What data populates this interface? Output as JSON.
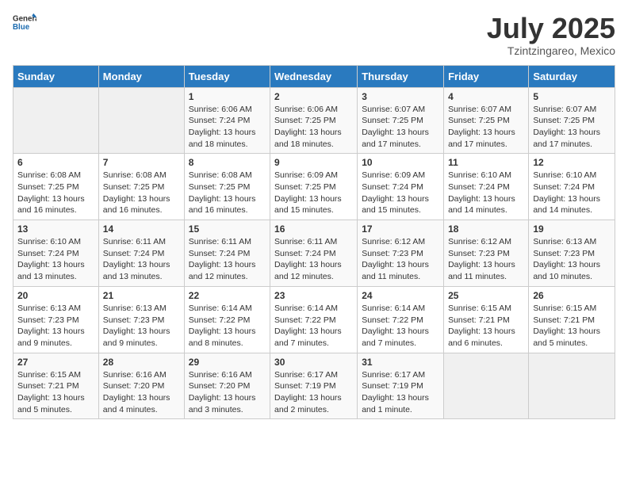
{
  "logo": {
    "general": "General",
    "blue": "Blue"
  },
  "title": {
    "month": "July 2025",
    "location": "Tzintzingareo, Mexico"
  },
  "weekdays": [
    "Sunday",
    "Monday",
    "Tuesday",
    "Wednesday",
    "Thursday",
    "Friday",
    "Saturday"
  ],
  "weeks": [
    [
      null,
      null,
      {
        "day": 1,
        "sunrise": "Sunrise: 6:06 AM",
        "sunset": "Sunset: 7:24 PM",
        "daylight": "Daylight: 13 hours and 18 minutes."
      },
      {
        "day": 2,
        "sunrise": "Sunrise: 6:06 AM",
        "sunset": "Sunset: 7:25 PM",
        "daylight": "Daylight: 13 hours and 18 minutes."
      },
      {
        "day": 3,
        "sunrise": "Sunrise: 6:07 AM",
        "sunset": "Sunset: 7:25 PM",
        "daylight": "Daylight: 13 hours and 17 minutes."
      },
      {
        "day": 4,
        "sunrise": "Sunrise: 6:07 AM",
        "sunset": "Sunset: 7:25 PM",
        "daylight": "Daylight: 13 hours and 17 minutes."
      },
      {
        "day": 5,
        "sunrise": "Sunrise: 6:07 AM",
        "sunset": "Sunset: 7:25 PM",
        "daylight": "Daylight: 13 hours and 17 minutes."
      }
    ],
    [
      {
        "day": 6,
        "sunrise": "Sunrise: 6:08 AM",
        "sunset": "Sunset: 7:25 PM",
        "daylight": "Daylight: 13 hours and 16 minutes."
      },
      {
        "day": 7,
        "sunrise": "Sunrise: 6:08 AM",
        "sunset": "Sunset: 7:25 PM",
        "daylight": "Daylight: 13 hours and 16 minutes."
      },
      {
        "day": 8,
        "sunrise": "Sunrise: 6:08 AM",
        "sunset": "Sunset: 7:25 PM",
        "daylight": "Daylight: 13 hours and 16 minutes."
      },
      {
        "day": 9,
        "sunrise": "Sunrise: 6:09 AM",
        "sunset": "Sunset: 7:25 PM",
        "daylight": "Daylight: 13 hours and 15 minutes."
      },
      {
        "day": 10,
        "sunrise": "Sunrise: 6:09 AM",
        "sunset": "Sunset: 7:24 PM",
        "daylight": "Daylight: 13 hours and 15 minutes."
      },
      {
        "day": 11,
        "sunrise": "Sunrise: 6:10 AM",
        "sunset": "Sunset: 7:24 PM",
        "daylight": "Daylight: 13 hours and 14 minutes."
      },
      {
        "day": 12,
        "sunrise": "Sunrise: 6:10 AM",
        "sunset": "Sunset: 7:24 PM",
        "daylight": "Daylight: 13 hours and 14 minutes."
      }
    ],
    [
      {
        "day": 13,
        "sunrise": "Sunrise: 6:10 AM",
        "sunset": "Sunset: 7:24 PM",
        "daylight": "Daylight: 13 hours and 13 minutes."
      },
      {
        "day": 14,
        "sunrise": "Sunrise: 6:11 AM",
        "sunset": "Sunset: 7:24 PM",
        "daylight": "Daylight: 13 hours and 13 minutes."
      },
      {
        "day": 15,
        "sunrise": "Sunrise: 6:11 AM",
        "sunset": "Sunset: 7:24 PM",
        "daylight": "Daylight: 13 hours and 12 minutes."
      },
      {
        "day": 16,
        "sunrise": "Sunrise: 6:11 AM",
        "sunset": "Sunset: 7:24 PM",
        "daylight": "Daylight: 13 hours and 12 minutes."
      },
      {
        "day": 17,
        "sunrise": "Sunrise: 6:12 AM",
        "sunset": "Sunset: 7:23 PM",
        "daylight": "Daylight: 13 hours and 11 minutes."
      },
      {
        "day": 18,
        "sunrise": "Sunrise: 6:12 AM",
        "sunset": "Sunset: 7:23 PM",
        "daylight": "Daylight: 13 hours and 11 minutes."
      },
      {
        "day": 19,
        "sunrise": "Sunrise: 6:13 AM",
        "sunset": "Sunset: 7:23 PM",
        "daylight": "Daylight: 13 hours and 10 minutes."
      }
    ],
    [
      {
        "day": 20,
        "sunrise": "Sunrise: 6:13 AM",
        "sunset": "Sunset: 7:23 PM",
        "daylight": "Daylight: 13 hours and 9 minutes."
      },
      {
        "day": 21,
        "sunrise": "Sunrise: 6:13 AM",
        "sunset": "Sunset: 7:23 PM",
        "daylight": "Daylight: 13 hours and 9 minutes."
      },
      {
        "day": 22,
        "sunrise": "Sunrise: 6:14 AM",
        "sunset": "Sunset: 7:22 PM",
        "daylight": "Daylight: 13 hours and 8 minutes."
      },
      {
        "day": 23,
        "sunrise": "Sunrise: 6:14 AM",
        "sunset": "Sunset: 7:22 PM",
        "daylight": "Daylight: 13 hours and 7 minutes."
      },
      {
        "day": 24,
        "sunrise": "Sunrise: 6:14 AM",
        "sunset": "Sunset: 7:22 PM",
        "daylight": "Daylight: 13 hours and 7 minutes."
      },
      {
        "day": 25,
        "sunrise": "Sunrise: 6:15 AM",
        "sunset": "Sunset: 7:21 PM",
        "daylight": "Daylight: 13 hours and 6 minutes."
      },
      {
        "day": 26,
        "sunrise": "Sunrise: 6:15 AM",
        "sunset": "Sunset: 7:21 PM",
        "daylight": "Daylight: 13 hours and 5 minutes."
      }
    ],
    [
      {
        "day": 27,
        "sunrise": "Sunrise: 6:15 AM",
        "sunset": "Sunset: 7:21 PM",
        "daylight": "Daylight: 13 hours and 5 minutes."
      },
      {
        "day": 28,
        "sunrise": "Sunrise: 6:16 AM",
        "sunset": "Sunset: 7:20 PM",
        "daylight": "Daylight: 13 hours and 4 minutes."
      },
      {
        "day": 29,
        "sunrise": "Sunrise: 6:16 AM",
        "sunset": "Sunset: 7:20 PM",
        "daylight": "Daylight: 13 hours and 3 minutes."
      },
      {
        "day": 30,
        "sunrise": "Sunrise: 6:17 AM",
        "sunset": "Sunset: 7:19 PM",
        "daylight": "Daylight: 13 hours and 2 minutes."
      },
      {
        "day": 31,
        "sunrise": "Sunrise: 6:17 AM",
        "sunset": "Sunset: 7:19 PM",
        "daylight": "Daylight: 13 hours and 1 minute."
      },
      null,
      null
    ]
  ]
}
